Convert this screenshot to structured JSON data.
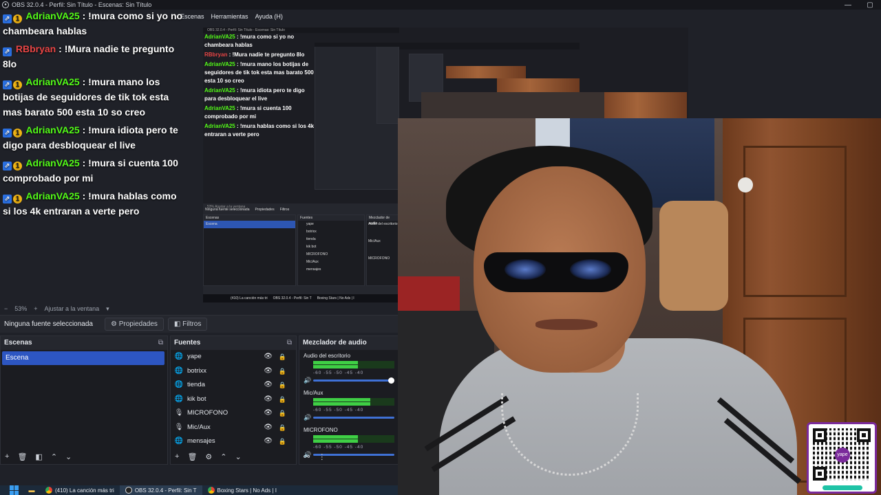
{
  "window": {
    "title": "OBS 32.0.4 - Perfil: Sin Título - Escenas: Sin Título",
    "controls": [
      "—",
      "▢"
    ]
  },
  "menu": {
    "items": [
      "Escenas",
      "Herramientas",
      "Ayuda (H)"
    ]
  },
  "chat": {
    "messages": [
      {
        "user": "AdrianVA25",
        "text": ": !mura como si yo no chambeara hablas"
      },
      {
        "user": "RBbryan",
        "text": ": !Mura nadie te pregunto 8lo"
      },
      {
        "user": "AdrianVA25",
        "text": ": !mura mano los botijas de seguidores de tik tok esta mas barato 500 esta 10 so creo"
      },
      {
        "user": "AdrianVA25",
        "text": ": !mura idiota pero te digo para desbloquear el live"
      },
      {
        "user": "AdrianVA25",
        "text": ": !mura si cuenta 100 comprobado por mi"
      },
      {
        "user": "AdrianVA25",
        "text": ": !mura hablas como si los 4k entraran a verte pero"
      }
    ]
  },
  "preview_mini": {
    "title": "OBS 32.0.4 - Perfil: Sin Título - Escenas: Sin Título",
    "menu": [
      "Escenas",
      "Herramientas",
      "Ayuda (H)"
    ],
    "zoom": "53%",
    "fit_label": "Ajustar a la ventana",
    "no_source": "Ninguna fuente seleccionada",
    "properties": "Propiedades",
    "filters": "Filtros",
    "scenes_title": "Escenas",
    "scene": "Escena",
    "sources_title": "Fuentes",
    "sources": [
      "yape",
      "botrixx",
      "tienda",
      "kik bot",
      "MICROFONO",
      "Mic/Aux",
      "mensajes"
    ],
    "mixer_title": "Mezclador de audio",
    "mixer_channels": [
      "Audio del escritorio",
      "Mic/Aux",
      "MICROFONO"
    ],
    "taskbar": [
      "(410) La canción más tri",
      "OBS 32.0.4 - Perfil: Sin T",
      "Boxing Stars | No Ads | I"
    ]
  },
  "zoombar": {
    "zoom": "53%",
    "fit_label": "Ajustar a la ventana"
  },
  "properties_bar": {
    "no_source": "Ninguna fuente seleccionada",
    "properties": "Propiedades",
    "filters": "Filtros"
  },
  "scenes": {
    "title": "Escenas",
    "items": [
      "Escena"
    ]
  },
  "sources": {
    "title": "Fuentes",
    "items": [
      {
        "name": "yape",
        "icon": "globe-icon"
      },
      {
        "name": "botrixx",
        "icon": "globe-icon"
      },
      {
        "name": "tienda",
        "icon": "globe-icon"
      },
      {
        "name": "kik bot",
        "icon": "globe-icon"
      },
      {
        "name": "MICROFONO",
        "icon": "microphone-icon"
      },
      {
        "name": "Mic/Aux",
        "icon": "microphone-icon"
      },
      {
        "name": "mensajes",
        "icon": "globe-icon"
      }
    ]
  },
  "mixer": {
    "title": "Mezclador de audio",
    "channels": [
      {
        "name": "Audio del escritorio",
        "ticks": "-60  -55  -50  -45  -40",
        "level": 0.55
      },
      {
        "name": "Mic/Aux",
        "ticks": "-60  -55  -50  -45  -40",
        "level": 0.7
      },
      {
        "name": "MICROFONO",
        "ticks": "-60  -55  -50  -45  -40",
        "level": 0.55
      }
    ]
  },
  "taskbar": {
    "apps": [
      {
        "label": "(410) La canción más tri",
        "icon": "chrome-icon",
        "active": false
      },
      {
        "label": "OBS 32.0.4 - Perfil: Sin T",
        "icon": "obs-icon",
        "active": true
      },
      {
        "label": "Boxing Stars | No Ads | I",
        "icon": "chrome-icon",
        "active": false
      }
    ]
  },
  "qr": {
    "logo_text": "yape"
  },
  "colors": {
    "username_green": "#53fc18",
    "username_red": "#e84545",
    "scene_selected": "#2d56c2",
    "meter_green": "#3fcf45"
  }
}
